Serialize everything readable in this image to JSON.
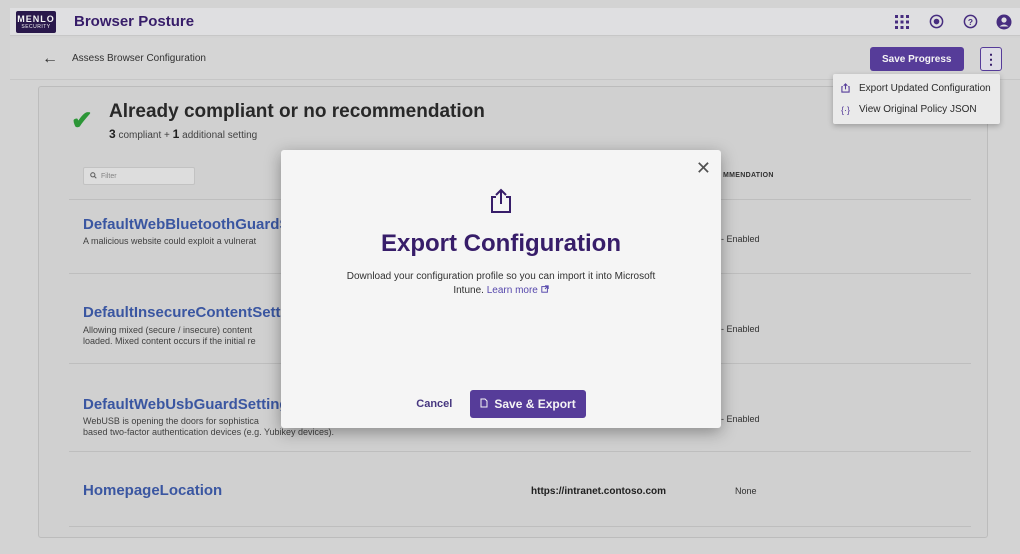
{
  "header": {
    "logo_line1": "MENLO",
    "logo_line2": "SECURITY",
    "app_title": "Browser Posture",
    "icons": [
      "apps-grid-icon",
      "notification-icon",
      "help-icon",
      "account-icon"
    ]
  },
  "subheader": {
    "breadcrumb": "Assess Browser Configuration",
    "save_progress_label": "Save Progress",
    "more_icon": "⋮"
  },
  "menu": {
    "items": [
      {
        "icon": "export-icon",
        "label": "Export Updated Configuration"
      },
      {
        "icon": "code-braces-icon",
        "label": "View Original Policy JSON"
      }
    ]
  },
  "section": {
    "title": "Already compliant or no recommendation",
    "count_compliant": "3",
    "compliant_text": "compliant +",
    "count_additional": "1",
    "additional_text": "additional setting",
    "filter_placeholder": "Filter",
    "col_header": "MMENDATION"
  },
  "rows": [
    {
      "name": "DefaultWebBluetoothGuardSet",
      "desc": "A malicious website could exploit a vulnerat",
      "value": "- Enabled"
    },
    {
      "name": "DefaultInsecureContentSetting",
      "desc": "Allowing mixed (secure / insecure) content",
      "desc2": "loaded. Mixed content occurs if the initial re",
      "value": "- Enabled"
    },
    {
      "name": "DefaultWebUsbGuardSetting",
      "desc": "WebUSB is opening the doors for sophistica",
      "desc2": "based two-factor authentication devices (e.g. Yubikey devices).",
      "value": "- Enabled"
    },
    {
      "name": "HomepageLocation",
      "url": "https://intranet.contoso.com",
      "value": "None"
    }
  ],
  "modal": {
    "title": "Export Configuration",
    "text": "Download your configuration profile so you can import it into Microsoft Intune.",
    "learn_more": "Learn more",
    "cancel_label": "Cancel",
    "save_export_label": "Save & Export",
    "close_icon": "close-icon",
    "share_icon": "share-icon"
  },
  "colors": {
    "brand_purple": "#5a3fa0",
    "title_purple": "#3a1f6e",
    "link_blue": "#3d5aa8",
    "check_green": "#2e9d3a"
  }
}
